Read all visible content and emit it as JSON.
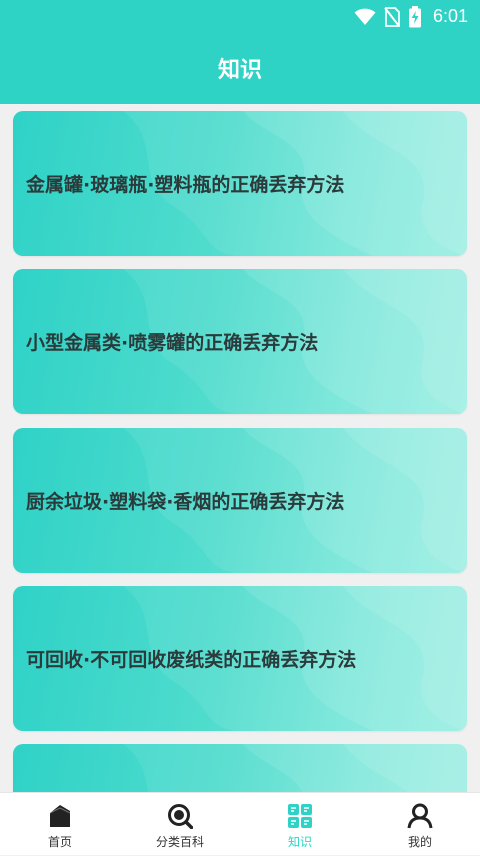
{
  "status_bar": {
    "time": "6:01",
    "icons": [
      "wifi-icon",
      "no-sim-icon",
      "battery-charging-icon"
    ]
  },
  "header": {
    "title": "知识"
  },
  "knowledge_list": {
    "items": [
      {
        "title": "金属罐·玻璃瓶·塑料瓶的正确丢弃方法"
      },
      {
        "title": "小型金属类·喷雾罐的正确丢弃方法"
      },
      {
        "title": "厨余垃圾·塑料袋·香烟的正确丢弃方法"
      },
      {
        "title": "可回收·不可回收废纸类的正确丢弃方法"
      },
      {
        "title": ""
      }
    ]
  },
  "tabbar": {
    "tabs": [
      {
        "label": "首页",
        "icon": "home-icon",
        "active": false
      },
      {
        "label": "分类百科",
        "icon": "search-icon",
        "active": false
      },
      {
        "label": "知识",
        "icon": "knowledge-grid-icon",
        "active": true
      },
      {
        "label": "我的",
        "icon": "person-icon",
        "active": false
      }
    ]
  },
  "colors": {
    "primary": "#2ed3c6",
    "card_gradient_end": "#8fede0",
    "card_text": "#2b3a3a",
    "page_background": "#f0f0f0",
    "tab_inactive": "#333333"
  }
}
